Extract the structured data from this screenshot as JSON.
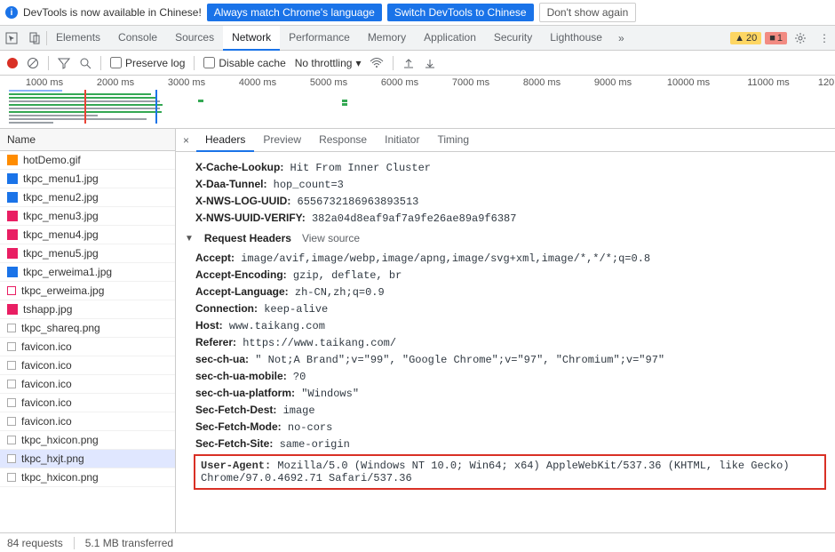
{
  "banner": {
    "text": "DevTools is now available in Chinese!",
    "btn1": "Always match Chrome's language",
    "btn2": "Switch DevTools to Chinese",
    "btn3": "Don't show again"
  },
  "tabs": [
    "Elements",
    "Console",
    "Sources",
    "Network",
    "Performance",
    "Memory",
    "Application",
    "Security",
    "Lighthouse"
  ],
  "active_tab": "Network",
  "warn_count": "20",
  "err_count": "1",
  "net_toolbar": {
    "preserve": "Preserve log",
    "disable_cache": "Disable cache",
    "throttling": "No throttling"
  },
  "timeline_ticks": [
    "1000 ms",
    "2000 ms",
    "3000 ms",
    "4000 ms",
    "5000 ms",
    "6000 ms",
    "7000 ms",
    "8000 ms",
    "9000 ms",
    "10000 ms",
    "11000 ms",
    "120"
  ],
  "sidebar": {
    "header": "Name",
    "files": [
      {
        "icon": "orange",
        "name": "hotDemo.gif"
      },
      {
        "icon": "blue",
        "name": "tkpc_menu1.jpg"
      },
      {
        "icon": "blue",
        "name": "tkpc_menu2.jpg"
      },
      {
        "icon": "pink",
        "name": "tkpc_menu3.jpg"
      },
      {
        "icon": "pink",
        "name": "tkpc_menu4.jpg"
      },
      {
        "icon": "pink",
        "name": "tkpc_menu5.jpg"
      },
      {
        "icon": "blue",
        "name": "tkpc_erweima1.jpg"
      },
      {
        "icon": "pinkbox",
        "name": "tkpc_erweima.jpg"
      },
      {
        "icon": "pink",
        "name": "tshapp.jpg"
      },
      {
        "icon": "empty",
        "name": "tkpc_shareq.png"
      },
      {
        "icon": "empty",
        "name": "favicon.ico"
      },
      {
        "icon": "empty",
        "name": "favicon.ico"
      },
      {
        "icon": "empty",
        "name": "favicon.ico"
      },
      {
        "icon": "empty",
        "name": "favicon.ico"
      },
      {
        "icon": "empty",
        "name": "favicon.ico"
      },
      {
        "icon": "empty",
        "name": "tkpc_hxicon.png"
      },
      {
        "icon": "empty",
        "name": "tkpc_hxjt.png",
        "selected": true
      },
      {
        "icon": "empty",
        "name": "tkpc_hxicon.png"
      }
    ]
  },
  "detail_tabs": [
    "Headers",
    "Preview",
    "Response",
    "Initiator",
    "Timing"
  ],
  "detail_active": "Headers",
  "response_partial": [
    {
      "k": "X-Cache-Lookup:",
      "v": "Hit From Inner Cluster"
    },
    {
      "k": "X-Daa-Tunnel:",
      "v": "hop_count=3"
    },
    {
      "k": "X-NWS-LOG-UUID:",
      "v": "6556732186963893513"
    },
    {
      "k": "X-NWS-UUID-VERIFY:",
      "v": "382a04d8eaf9af7a9fe26ae89a9f6387"
    }
  ],
  "request_section": {
    "title": "Request Headers",
    "link": "View source"
  },
  "request_headers": [
    {
      "k": "Accept:",
      "v": "image/avif,image/webp,image/apng,image/svg+xml,image/*,*/*;q=0.8"
    },
    {
      "k": "Accept-Encoding:",
      "v": "gzip, deflate, br"
    },
    {
      "k": "Accept-Language:",
      "v": "zh-CN,zh;q=0.9"
    },
    {
      "k": "Connection:",
      "v": "keep-alive"
    },
    {
      "k": "Host:",
      "v": "www.taikang.com"
    },
    {
      "k": "Referer:",
      "v": "https://www.taikang.com/"
    },
    {
      "k": "sec-ch-ua:",
      "v": "\" Not;A Brand\";v=\"99\", \"Google Chrome\";v=\"97\", \"Chromium\";v=\"97\""
    },
    {
      "k": "sec-ch-ua-mobile:",
      "v": "?0"
    },
    {
      "k": "sec-ch-ua-platform:",
      "v": "\"Windows\""
    },
    {
      "k": "Sec-Fetch-Dest:",
      "v": "image"
    },
    {
      "k": "Sec-Fetch-Mode:",
      "v": "no-cors"
    },
    {
      "k": "Sec-Fetch-Site:",
      "v": "same-origin"
    }
  ],
  "user_agent": {
    "k": "User-Agent:",
    "v": "Mozilla/5.0 (Windows NT 10.0; Win64; x64) AppleWebKit/537.36 (KHTML, like Gecko) Chrome/97.0.4692.71 Safari/537.36"
  },
  "status": {
    "requests": "84 requests",
    "transferred": "5.1 MB transferred"
  }
}
